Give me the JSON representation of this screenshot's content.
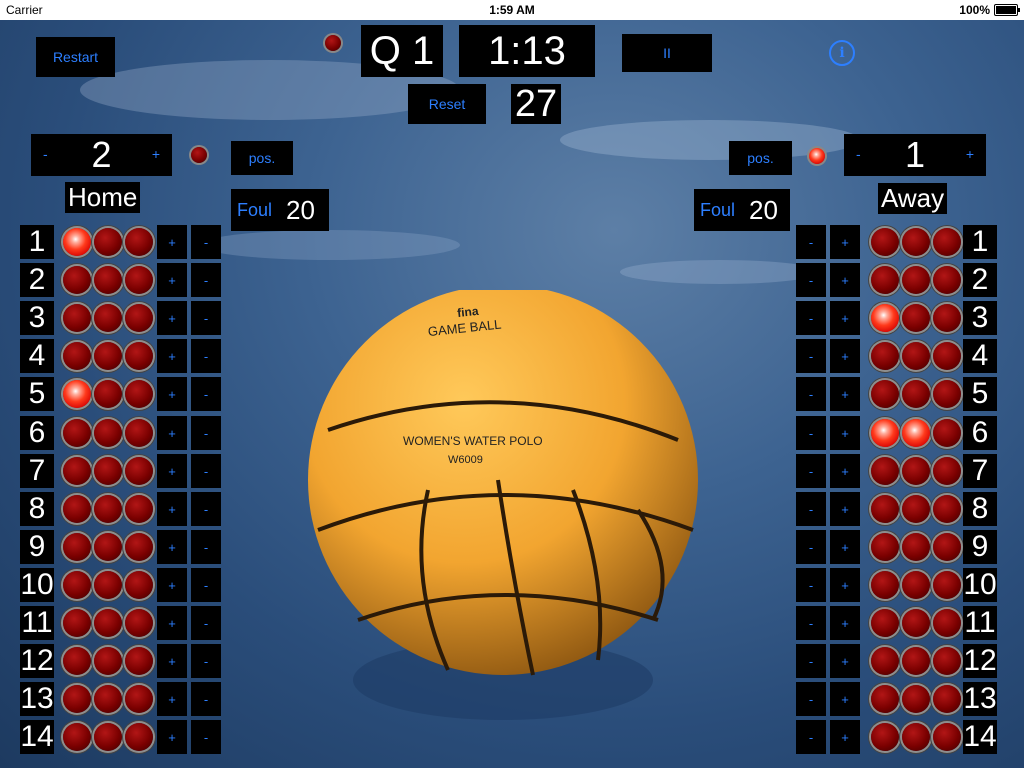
{
  "status": {
    "carrier": "Carrier",
    "time": "1:59 AM",
    "battery": "100%"
  },
  "controls": {
    "restart": "Restart",
    "reset": "Reset",
    "pause": "II",
    "pos": "pos.",
    "foul_label": "Foul",
    "minus": "-",
    "plus": "+"
  },
  "clock": {
    "quarter": "Q 1",
    "game_clock": "1:13",
    "shot_clock": "27",
    "running_indicator_on": false
  },
  "home": {
    "name": "Home",
    "score": "2",
    "foul_time": "20",
    "possession_indicator_on": false,
    "caps": [
      {
        "number": "1",
        "exclusions": [
          true,
          false,
          false
        ]
      },
      {
        "number": "2",
        "exclusions": [
          false,
          false,
          false
        ]
      },
      {
        "number": "3",
        "exclusions": [
          false,
          false,
          false
        ]
      },
      {
        "number": "4",
        "exclusions": [
          false,
          false,
          false
        ]
      },
      {
        "number": "5",
        "exclusions": [
          true,
          false,
          false
        ]
      },
      {
        "number": "6",
        "exclusions": [
          false,
          false,
          false
        ]
      },
      {
        "number": "7",
        "exclusions": [
          false,
          false,
          false
        ]
      },
      {
        "number": "8",
        "exclusions": [
          false,
          false,
          false
        ]
      },
      {
        "number": "9",
        "exclusions": [
          false,
          false,
          false
        ]
      },
      {
        "number": "10",
        "exclusions": [
          false,
          false,
          false
        ]
      },
      {
        "number": "11",
        "exclusions": [
          false,
          false,
          false
        ]
      },
      {
        "number": "12",
        "exclusions": [
          false,
          false,
          false
        ]
      },
      {
        "number": "13",
        "exclusions": [
          false,
          false,
          false
        ]
      },
      {
        "number": "14",
        "exclusions": [
          false,
          false,
          false
        ]
      }
    ]
  },
  "away": {
    "name": "Away",
    "score": "1",
    "foul_time": "20",
    "possession_indicator_on": true,
    "caps": [
      {
        "number": "1",
        "exclusions": [
          false,
          false,
          false
        ]
      },
      {
        "number": "2",
        "exclusions": [
          false,
          false,
          false
        ]
      },
      {
        "number": "3",
        "exclusions": [
          true,
          false,
          false
        ]
      },
      {
        "number": "4",
        "exclusions": [
          false,
          false,
          false
        ]
      },
      {
        "number": "5",
        "exclusions": [
          false,
          false,
          false
        ]
      },
      {
        "number": "6",
        "exclusions": [
          true,
          true,
          false
        ]
      },
      {
        "number": "7",
        "exclusions": [
          false,
          false,
          false
        ]
      },
      {
        "number": "8",
        "exclusions": [
          false,
          false,
          false
        ]
      },
      {
        "number": "9",
        "exclusions": [
          false,
          false,
          false
        ]
      },
      {
        "number": "10",
        "exclusions": [
          false,
          false,
          false
        ]
      },
      {
        "number": "11",
        "exclusions": [
          false,
          false,
          false
        ]
      },
      {
        "number": "12",
        "exclusions": [
          false,
          false,
          false
        ]
      },
      {
        "number": "13",
        "exclusions": [
          false,
          false,
          false
        ]
      },
      {
        "number": "14",
        "exclusions": [
          false,
          false,
          false
        ]
      }
    ]
  },
  "ball": {
    "brand": "fina",
    "line1": "GAME BALL",
    "line2": "WOMEN'S WATER POLO",
    "line3": "W6009"
  }
}
